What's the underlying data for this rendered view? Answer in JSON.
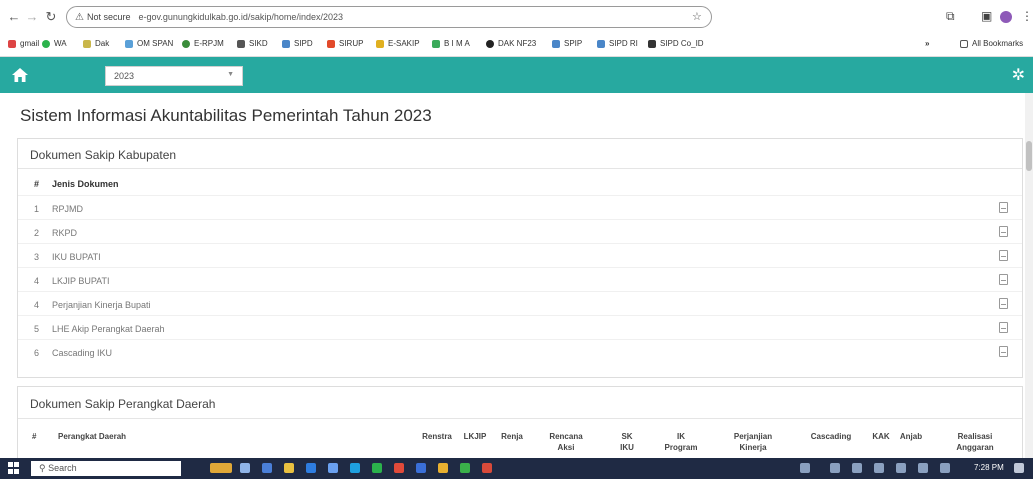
{
  "browser": {
    "security_label": "Not secure",
    "url": "e-gov.gunungkidulkab.go.id/sakip/home/index/2023",
    "bookmarks": [
      "gmail",
      "WA",
      "Dak",
      "OM SPAN",
      "E-RPJM",
      "SIKD",
      "SIPD",
      "SIRUP",
      "E-SAKIP",
      "B I M A",
      "DAK NF23",
      "SPIP",
      "SIPD RI",
      "SIPD Co_ID"
    ],
    "all_bookmarks": "All Bookmarks"
  },
  "appbar": {
    "year": "2023"
  },
  "page": {
    "title": "Sistem Informasi Akuntabilitas Pemerintah Tahun 2023"
  },
  "kabupaten": {
    "heading": "Dokumen Sakip Kabupaten",
    "col_num": "#",
    "col_name": "Jenis Dokumen",
    "rows": [
      {
        "num": "1",
        "name": "RPJMD"
      },
      {
        "num": "2",
        "name": "RKPD"
      },
      {
        "num": "3",
        "name": "IKU BUPATI"
      },
      {
        "num": "4",
        "name": "LKJIP BUPATI"
      },
      {
        "num": "4",
        "name": "Perjanjian Kinerja Bupati"
      },
      {
        "num": "5",
        "name": "LHE Akip Perangkat Daerah"
      },
      {
        "num": "6",
        "name": "Cascading IKU"
      }
    ]
  },
  "perangkat": {
    "heading": "Dokumen Sakip Perangkat Daerah",
    "col_num": "#",
    "col_name": "Perangkat Daerah",
    "columns": [
      "Renstra",
      "LKJIP",
      "Renja",
      "Rencana Aksi",
      "SK IKU",
      "IK Program",
      "Perjanjian Kinerja",
      "Cascading",
      "KAK",
      "Anjab",
      "Realisasi Anggaran"
    ]
  },
  "taskbar": {
    "search": "Search",
    "time": "7:28 PM"
  }
}
